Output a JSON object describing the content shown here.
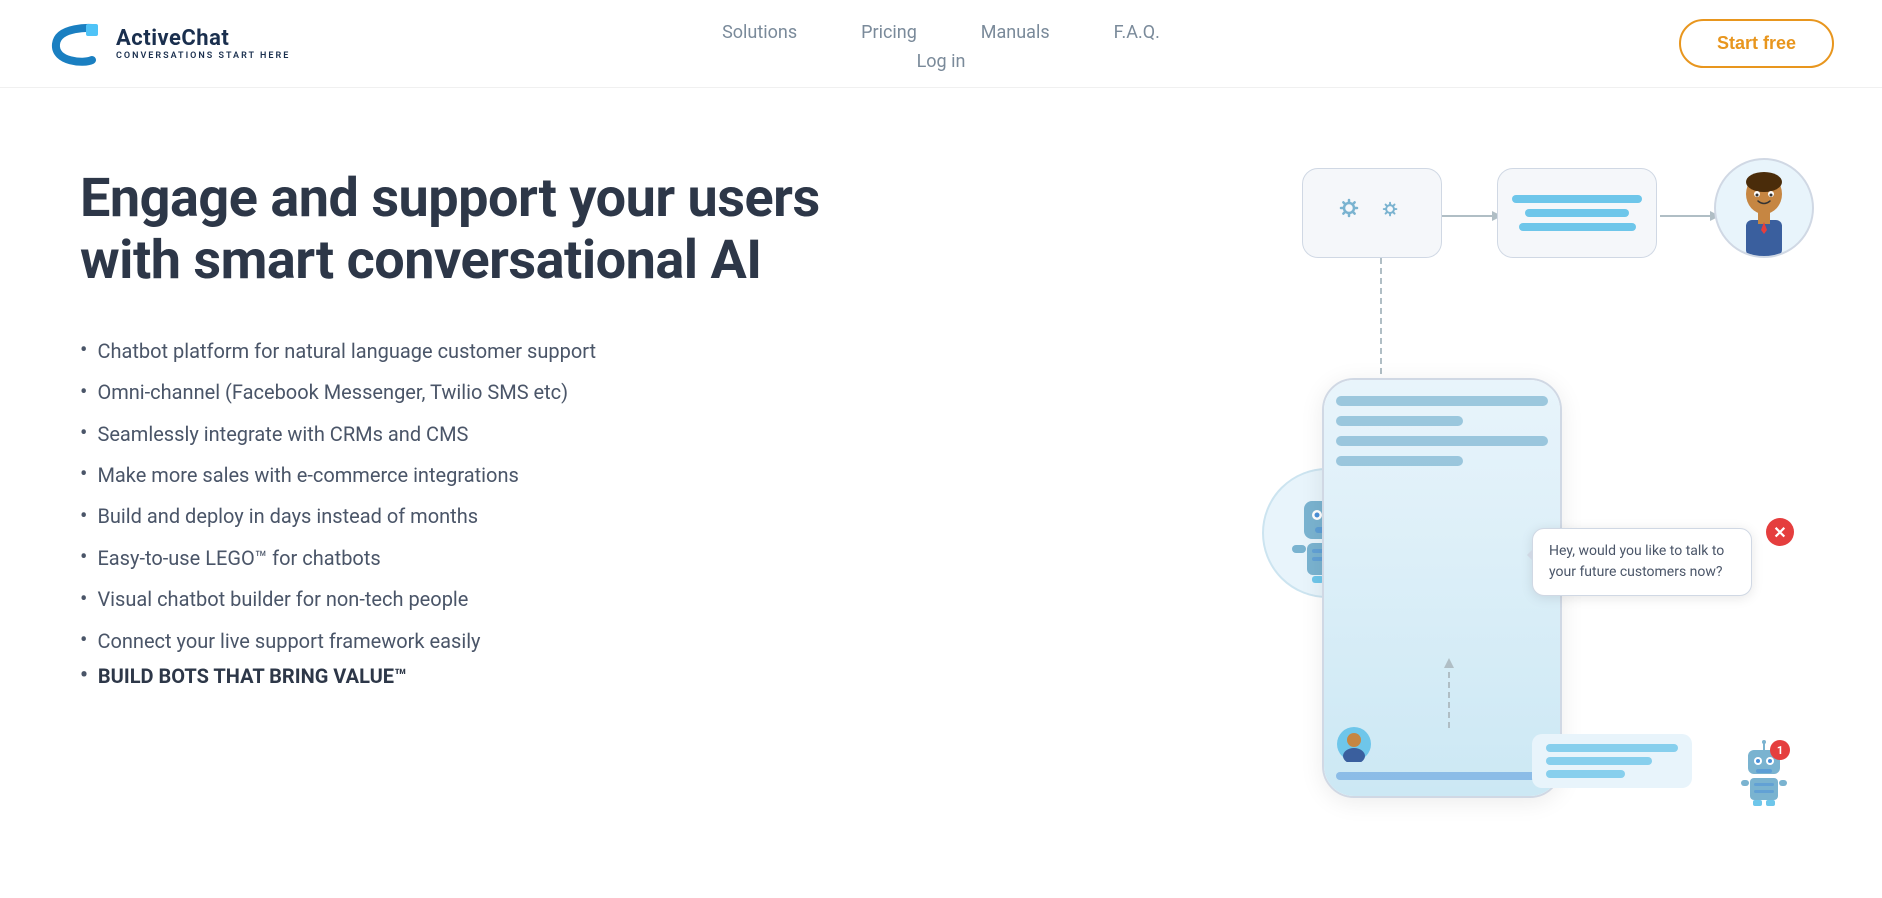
{
  "brand": {
    "name": "ActiveChat",
    "tagline": "CONVERSATIONS START HERE"
  },
  "nav": {
    "items": [
      "Solutions",
      "Pricing",
      "Manuals",
      "F.A.Q."
    ],
    "login": "Log in"
  },
  "cta": {
    "start_free": "Start free"
  },
  "hero": {
    "title_line1": "Engage and support your users",
    "title_line2": "with smart conversational AI",
    "bullets": [
      "Chatbot platform for natural language customer support",
      "Omni-channel (Facebook Messenger, Twilio SMS etc)",
      "Seamlessly integrate with CRMs and CMS",
      "Make more sales with e-commerce integrations",
      "Build and deploy in days instead of months",
      "Easy-to-use LEGO™ for chatbots",
      "Visual chatbot builder for non-tech people",
      "Connect your live support framework easily"
    ],
    "last_bullet": "BUILD BOTS THAT BRING VALUE™"
  },
  "chat_popup": {
    "text": "Hey, would you like to talk to your future customers now?"
  },
  "notification": {
    "count": "1"
  }
}
